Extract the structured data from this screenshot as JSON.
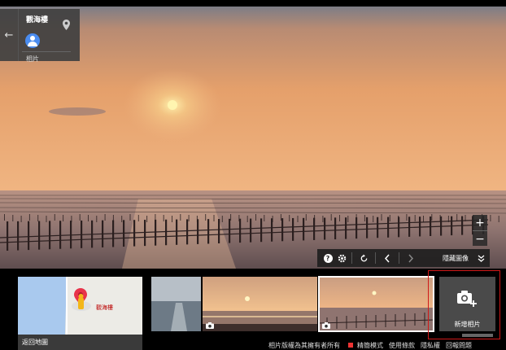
{
  "place": {
    "title": "觀海樓",
    "photos_label": "相片"
  },
  "controls": {
    "hide_images_label": "隱藏圖像"
  },
  "map_thumb": {
    "label": "返回地圖",
    "place_name": "觀海樓"
  },
  "add_photo": {
    "label": "新增相片"
  },
  "footer": {
    "copyright": "相片版權為其擁有者所有",
    "lite_mode": "精簡模式",
    "terms": "使用條款",
    "privacy": "隱私權",
    "report": "回報問題"
  },
  "icons": [
    "back-arrow-icon",
    "location-pin-icon",
    "zoom-in-icon",
    "zoom-out-icon",
    "help-icon",
    "settings-icon",
    "rotate-icon",
    "previous-icon",
    "next-icon",
    "collapse-icon",
    "camera-icon",
    "add-camera-icon"
  ],
  "colors": {
    "sky_top": "#7d7d86",
    "sky_mid": "#e7a26a",
    "sun": "#fff5b0",
    "highlight_red": "#d01818"
  }
}
